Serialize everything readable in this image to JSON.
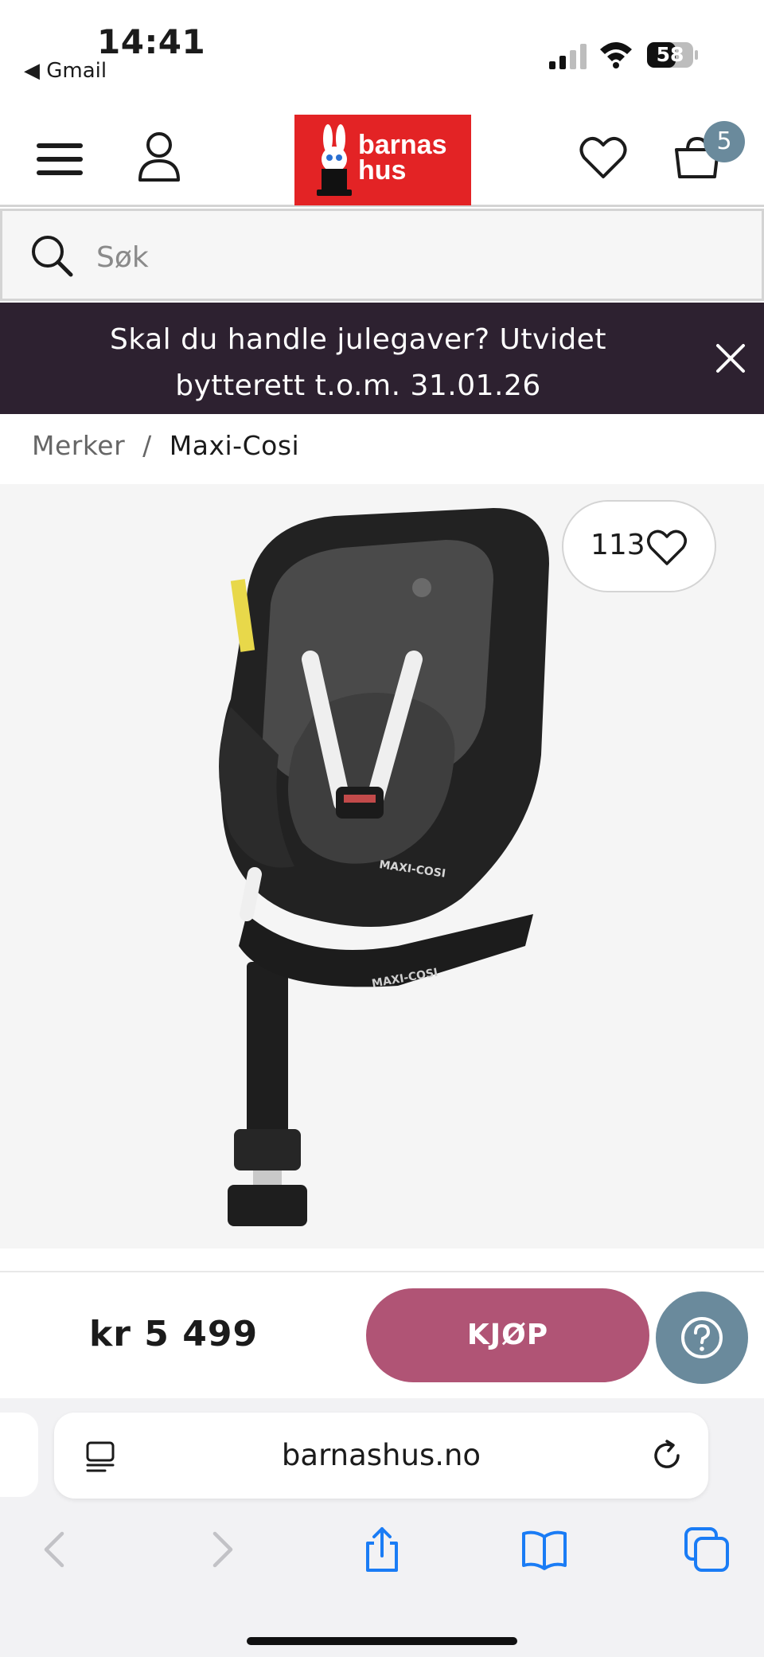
{
  "status_bar": {
    "time": "14:41",
    "back_app": "◀ Gmail",
    "battery": "58"
  },
  "header": {
    "logo_line1": "barnas",
    "logo_line2": "hus",
    "cart_count": "5"
  },
  "search": {
    "placeholder": "Søk"
  },
  "promo_banner": {
    "text": "Skal du handle julegaver? Utvidet bytterett t.o.m. 31.01.26"
  },
  "breadcrumb": {
    "items": [
      "Merker",
      "Maxi-Cosi"
    ],
    "separator": "/"
  },
  "product": {
    "favorite_count": "113",
    "price": "kr 5 499",
    "buy_label": "KJØP",
    "seat_brand_text": "MAXI-COSI"
  },
  "browser": {
    "url": "barnashus.no"
  },
  "colors": {
    "logo_red": "#e32325",
    "banner_bg": "#2d2130",
    "buy_button": "#b05475",
    "accent_blue_gray": "#6a8a9c",
    "safari_blue": "#1a7cf5"
  }
}
